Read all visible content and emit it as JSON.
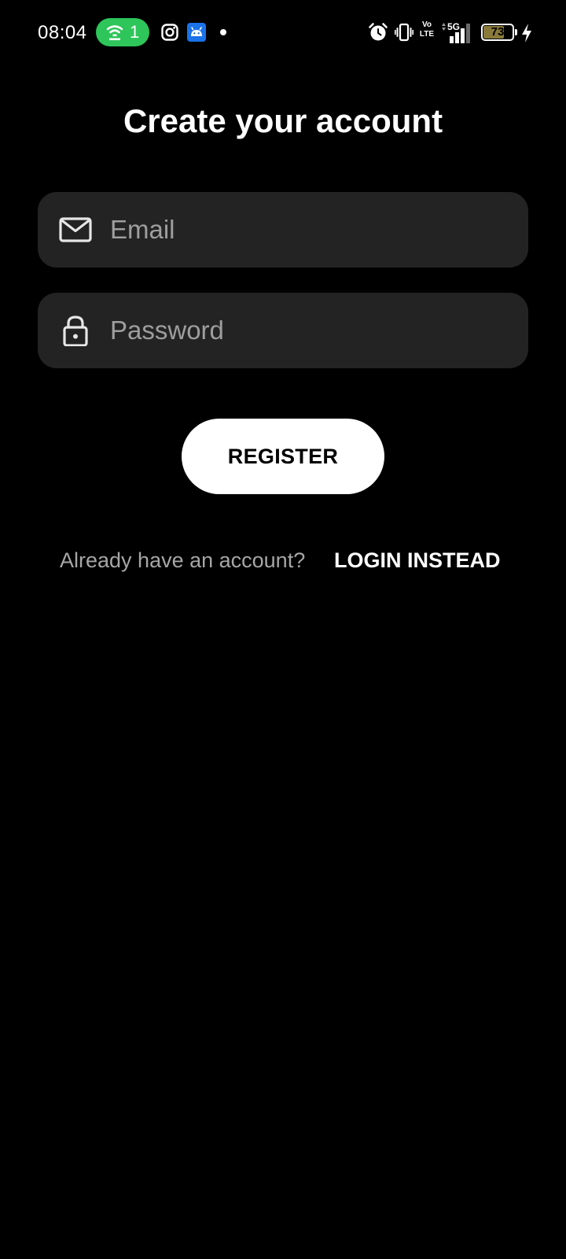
{
  "status_bar": {
    "time": "08:04",
    "hotspot_count": "1",
    "hotspot_color": "#2ec55a",
    "notification_icons": [
      "wifi-hotspot-icon",
      "instagram-icon",
      "android-app-icon"
    ],
    "system_icons": [
      "alarm-icon",
      "vibrate-icon",
      "volte-icon",
      "signal-5g-icon",
      "battery-icon",
      "charging-icon"
    ],
    "volte_line1": "Vo",
    "volte_line2": "LTE",
    "network_label": "5G",
    "battery_level": "73",
    "battery_fraction": 0.73
  },
  "form": {
    "title": "Create your account",
    "email": {
      "placeholder": "Email",
      "value": "",
      "icon": "mail-icon"
    },
    "password": {
      "placeholder": "Password",
      "value": "",
      "icon": "lock-icon"
    },
    "register_label": "REGISTER"
  },
  "footer": {
    "prompt": "Already have an account?",
    "login_label": "LOGIN INSTEAD"
  },
  "colors": {
    "background": "#000000",
    "field_background": "#232323",
    "placeholder_text": "#9e9e9e",
    "primary_button": "#ffffff",
    "muted_text": "#a6a6a6"
  }
}
